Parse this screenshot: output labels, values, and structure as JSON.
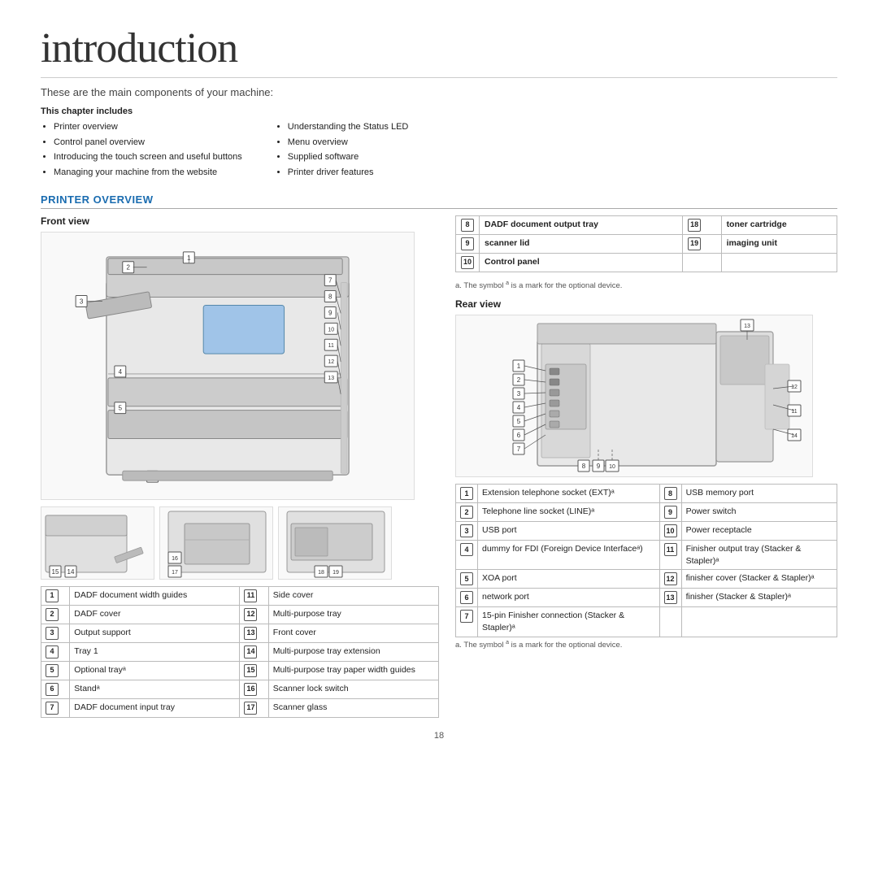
{
  "page": {
    "title": "introduction",
    "subtitle": "These are the main components of your machine:",
    "chapter_includes_label": "This chapter includes",
    "left_list": [
      "Printer overview",
      "Control panel overview",
      "Introducing the touch screen and useful buttons",
      "Managing your machine from the website"
    ],
    "right_list": [
      "Understanding the Status LED",
      "Menu overview",
      "Supplied software",
      "Printer driver features"
    ],
    "section_title": "PRINTER OVERVIEW",
    "front_view_title": "Front view",
    "rear_view_title": "Rear view",
    "note_front": "a. The symbol a is a mark for the optional device.",
    "note_rear": "a. The symbol a is a mark for the optional device.",
    "page_number": "18"
  },
  "front_parts": [
    {
      "num": "1",
      "label": "DADF document width guides",
      "num2": "11",
      "label2": "Side cover"
    },
    {
      "num": "2",
      "label": "DADF cover",
      "num2": "12",
      "label2": "Multi-purpose tray"
    },
    {
      "num": "3",
      "label": "Output support",
      "num2": "13",
      "label2": "Front cover"
    },
    {
      "num": "4",
      "label": "Tray 1",
      "num2": "14",
      "label2": "Multi-purpose tray extension"
    },
    {
      "num": "5",
      "label": "Optional trayᵃ",
      "num2": "15",
      "label2": "Multi-purpose tray paper width guides"
    },
    {
      "num": "6",
      "label": "Standᵃ",
      "num2": "16",
      "label2": "Scanner lock switch"
    },
    {
      "num": "7",
      "label": "DADF document input tray",
      "num2": "17",
      "label2": "Scanner glass"
    }
  ],
  "right_component_table": [
    {
      "num": "8",
      "label": "DADF document output tray",
      "num2": "18",
      "label2": "toner cartridge"
    },
    {
      "num": "9",
      "label": "scanner lid",
      "num2": "19",
      "label2": "imaging unit"
    },
    {
      "num": "10",
      "label": "Control panel",
      "num2": "",
      "label2": ""
    }
  ],
  "rear_parts": [
    {
      "num": "1",
      "label": "Extension telephone socket (EXT)ᵃ",
      "num2": "8",
      "label2": "USB memory port"
    },
    {
      "num": "2",
      "label": "Telephone line socket (LINE)ᵃ",
      "num2": "9",
      "label2": "Power switch"
    },
    {
      "num": "3",
      "label": "USB port",
      "num2": "10",
      "label2": "Power receptacle"
    },
    {
      "num": "4",
      "label": "dummy for FDI (Foreign Device Interfaceᵃ)",
      "num2": "11",
      "label2": "Finisher output tray (Stacker & Stapler)ᵃ"
    },
    {
      "num": "5",
      "label": "XOA port",
      "num2": "12",
      "label2": "finisher cover (Stacker & Stapler)ᵃ"
    },
    {
      "num": "6",
      "label": "network port",
      "num2": "13",
      "label2": "finisher (Stacker & Stapler)ᵃ"
    },
    {
      "num": "7",
      "label": "15-pin Finisher connection (Stacker & Stapler)ᵃ",
      "num2": "",
      "label2": ""
    }
  ]
}
